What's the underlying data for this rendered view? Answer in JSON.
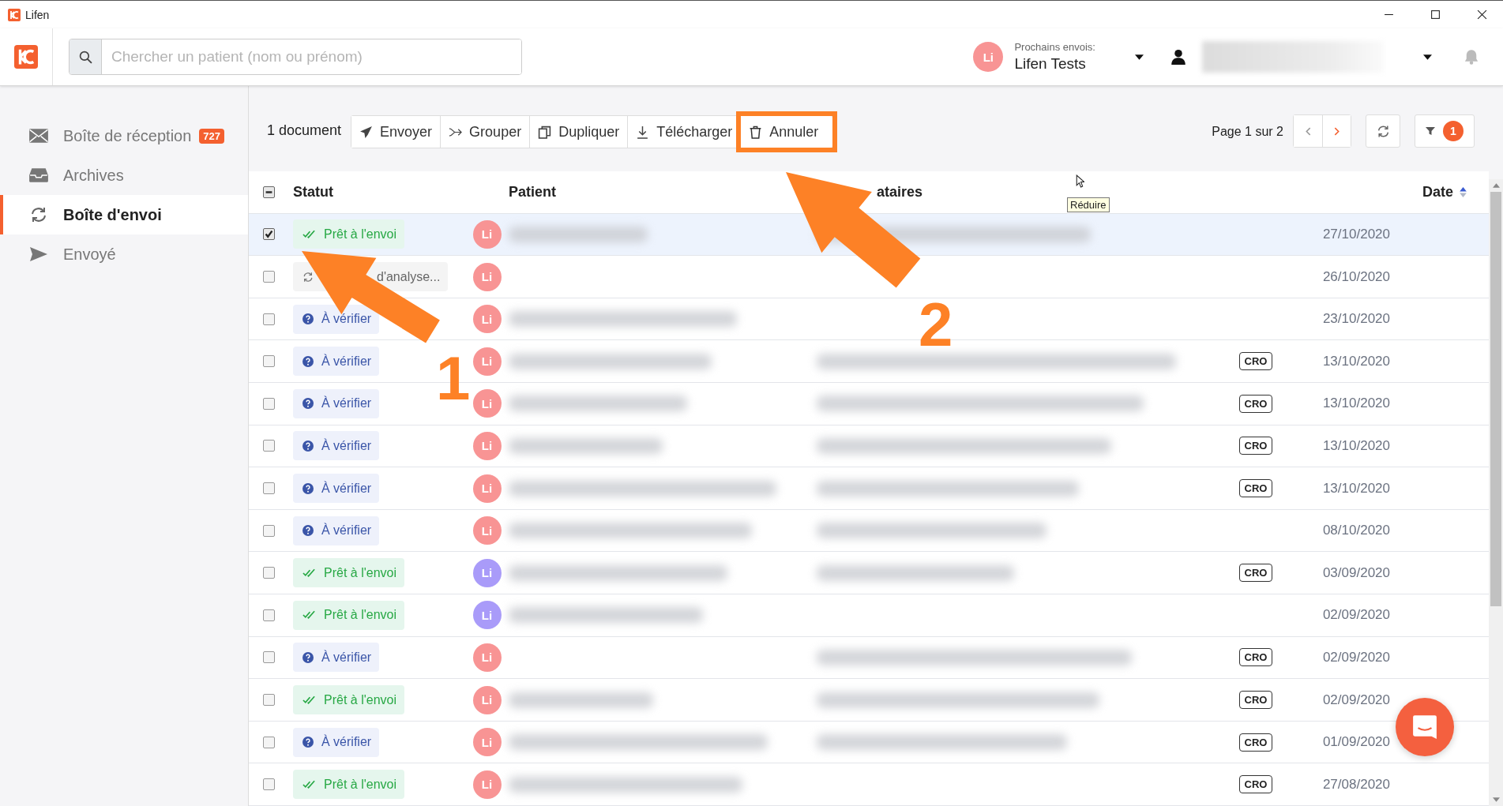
{
  "window": {
    "title": "Lifen"
  },
  "header": {
    "search": {
      "placeholder": "Chercher un patient (nom ou prénom)"
    },
    "sender": {
      "avatar": "Li",
      "caption": "Prochains envois:",
      "name": "Lifen Tests"
    },
    "user_redacted": true
  },
  "sidebar": {
    "items": [
      {
        "label": "Boîte de réception",
        "badge": "727",
        "selected": false
      },
      {
        "label": "Archives",
        "selected": false
      },
      {
        "label": "Boîte d'envoi",
        "selected": true
      },
      {
        "label": "Envoyé",
        "selected": false
      }
    ]
  },
  "toolbar": {
    "count": "1 document",
    "actions": [
      {
        "label": "Envoyer",
        "highlighted": false
      },
      {
        "label": "Grouper",
        "highlighted": false
      },
      {
        "label": "Dupliquer",
        "highlighted": false
      },
      {
        "label": "Télécharger",
        "highlighted": false
      },
      {
        "label": "Annuler",
        "highlighted": true
      }
    ],
    "pagination": "Page 1 sur 2",
    "prev_disabled": true,
    "next_disabled": false,
    "filter_badge": "1"
  },
  "table": {
    "columns": [
      "Statut",
      "Patient",
      "ataires",
      "Date"
    ],
    "select_all_partial": true,
    "rows": [
      {
        "checked": true,
        "selected": true,
        "status": {
          "kind": "ready",
          "label": "Prêt à l'envoi"
        },
        "avatar": "Li",
        "color": "#f89494",
        "patient_redacted": true,
        "recipient_redacted": true,
        "tag": "",
        "date": "27/10/2020"
      },
      {
        "checked": false,
        "selected": false,
        "status": {
          "kind": "analyse",
          "label": "d'analyse..."
        },
        "avatar": "Li",
        "color": "#f89494",
        "patient_redacted": false,
        "recipient_redacted": false,
        "tag": "",
        "date": "26/10/2020"
      },
      {
        "checked": false,
        "selected": false,
        "status": {
          "kind": "verify",
          "label": "À vérifier"
        },
        "avatar": "Li",
        "color": "#f89494",
        "patient_redacted": true,
        "recipient_redacted": false,
        "tag": "",
        "date": "23/10/2020"
      },
      {
        "checked": false,
        "selected": false,
        "status": {
          "kind": "verify",
          "label": "À vérifier"
        },
        "avatar": "Li",
        "color": "#f89494",
        "patient_redacted": true,
        "recipient_redacted": true,
        "tag": "CRO",
        "date": "13/10/2020"
      },
      {
        "checked": false,
        "selected": false,
        "status": {
          "kind": "verify",
          "label": "À vérifier"
        },
        "avatar": "Li",
        "color": "#f89494",
        "patient_redacted": true,
        "recipient_redacted": true,
        "tag": "CRO",
        "date": "13/10/2020"
      },
      {
        "checked": false,
        "selected": false,
        "status": {
          "kind": "verify",
          "label": "À vérifier"
        },
        "avatar": "Li",
        "color": "#f89494",
        "patient_redacted": true,
        "recipient_redacted": true,
        "tag": "CRO",
        "date": "13/10/2020"
      },
      {
        "checked": false,
        "selected": false,
        "status": {
          "kind": "verify",
          "label": "À vérifier"
        },
        "avatar": "Li",
        "color": "#f89494",
        "patient_redacted": true,
        "recipient_redacted": true,
        "tag": "CRO",
        "date": "13/10/2020"
      },
      {
        "checked": false,
        "selected": false,
        "status": {
          "kind": "verify",
          "label": "À vérifier"
        },
        "avatar": "Li",
        "color": "#f89494",
        "patient_redacted": true,
        "recipient_redacted": true,
        "tag": "",
        "date": "08/10/2020"
      },
      {
        "checked": false,
        "selected": false,
        "status": {
          "kind": "ready",
          "label": "Prêt à l'envoi"
        },
        "avatar": "Li",
        "color": "#a99bf9",
        "patient_redacted": true,
        "recipient_redacted": true,
        "tag": "CRO",
        "date": "03/09/2020"
      },
      {
        "checked": false,
        "selected": false,
        "status": {
          "kind": "ready",
          "label": "Prêt à l'envoi"
        },
        "avatar": "Li",
        "color": "#a99bf9",
        "patient_redacted": true,
        "recipient_redacted": false,
        "tag": "",
        "date": "02/09/2020"
      },
      {
        "checked": false,
        "selected": false,
        "status": {
          "kind": "verify",
          "label": "À vérifier"
        },
        "avatar": "Li",
        "color": "#f89494",
        "patient_redacted": false,
        "recipient_redacted": true,
        "tag": "CRO",
        "date": "02/09/2020"
      },
      {
        "checked": false,
        "selected": false,
        "status": {
          "kind": "ready",
          "label": "Prêt à l'envoi"
        },
        "avatar": "Li",
        "color": "#f89494",
        "patient_redacted": true,
        "recipient_redacted": true,
        "tag": "CRO",
        "date": "02/09/2020"
      },
      {
        "checked": false,
        "selected": false,
        "status": {
          "kind": "verify",
          "label": "À vérifier"
        },
        "avatar": "Li",
        "color": "#f89494",
        "patient_redacted": true,
        "recipient_redacted": true,
        "tag": "CRO",
        "date": "01/09/2020"
      },
      {
        "checked": false,
        "selected": false,
        "status": {
          "kind": "ready",
          "label": "Prêt à l'envoi"
        },
        "avatar": "Li",
        "color": "#f89494",
        "patient_redacted": true,
        "recipient_redacted": false,
        "tag": "CRO",
        "date": "27/08/2020"
      }
    ]
  },
  "tooltip": {
    "text": "Réduire"
  },
  "annotations": [
    {
      "label": "1"
    },
    {
      "label": "2"
    }
  ]
}
